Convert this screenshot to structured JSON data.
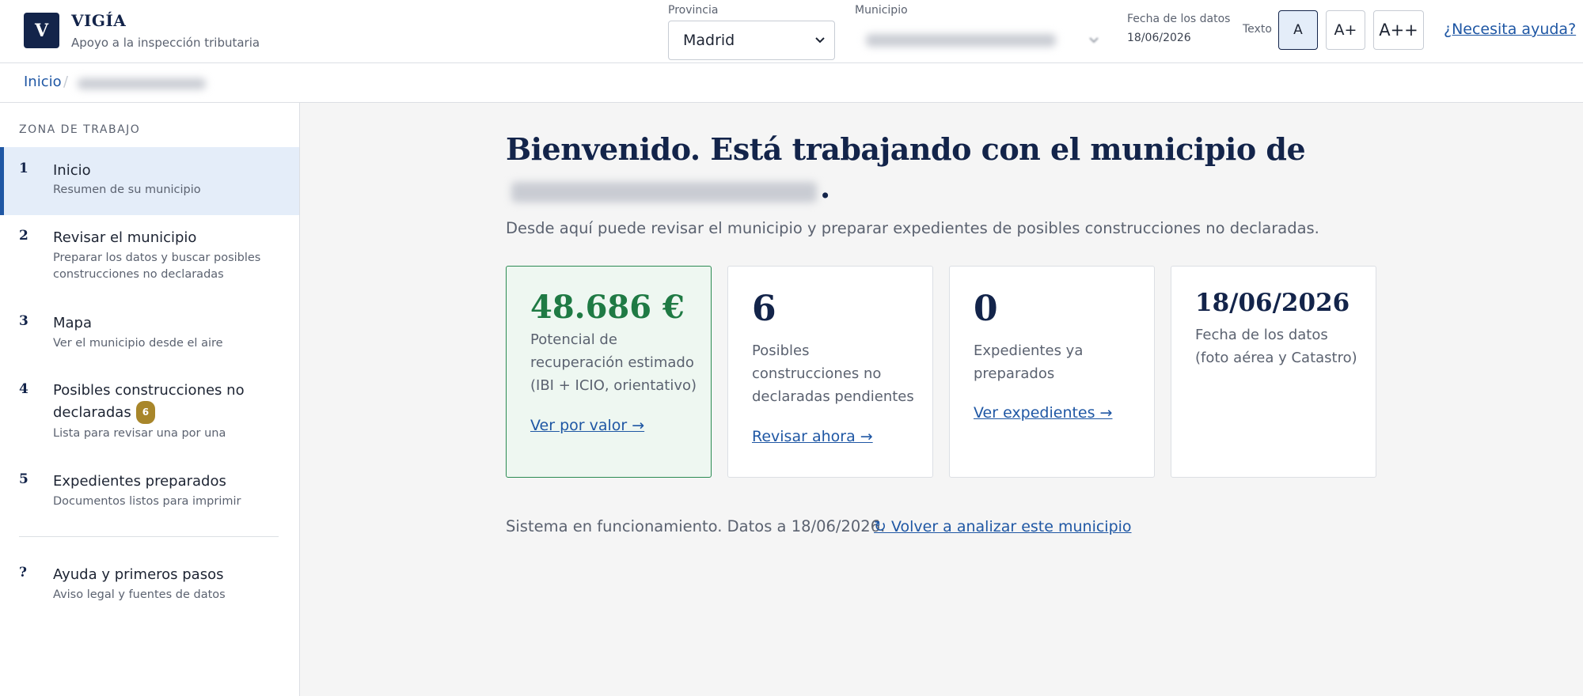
{
  "brand": {
    "logo_letter": "V",
    "name": "VIGÍA",
    "subtitle": "Apoyo a la inspección tributaria"
  },
  "header": {
    "provincia_label": "Provincia",
    "provincia_value": "Madrid",
    "municipio_label": "Municipio",
    "fecha_label": "Fecha de los datos",
    "fecha_value": "18/06/2026",
    "texto_label": "Texto",
    "size_buttons": [
      "A",
      "A+",
      "A++"
    ],
    "help_link": "¿Necesita ayuda?"
  },
  "breadcrumb": {
    "home": "Inicio",
    "separator": "/"
  },
  "sidebar": {
    "heading": "ZONA DE TRABAJO",
    "items": [
      {
        "num": "1",
        "title": "Inicio",
        "desc": "Resumen de su municipio"
      },
      {
        "num": "2",
        "title": "Revisar el municipio",
        "desc": "Preparar los datos y buscar posibles construcciones no declaradas"
      },
      {
        "num": "3",
        "title": "Mapa",
        "desc": "Ver el municipio desde el aire"
      },
      {
        "num": "4",
        "title": "Posibles construcciones no declaradas",
        "badge": "6",
        "desc": "Lista para revisar una por una"
      },
      {
        "num": "5",
        "title": "Expedientes preparados",
        "desc": "Documentos listos para imprimir"
      },
      {
        "num": "?",
        "title": "Ayuda y primeros pasos",
        "desc": "Aviso legal y fuentes de datos"
      }
    ]
  },
  "main": {
    "title": "Bienvenido. Está trabajando con el municipio de",
    "title_end": ".",
    "subtitle": "Desde aquí puede revisar el municipio y preparar expedientes de posibles construcciones no declaradas.",
    "cards": [
      {
        "value": "48.686 €",
        "desc": "Potencial de recuperación estimado (IBI + ICIO, orientativo)",
        "link": "Ver por valor →"
      },
      {
        "value": "6",
        "desc": "Posibles construcciones no declaradas pendientes",
        "link": "Revisar ahora →"
      },
      {
        "value": "0",
        "desc": "Expedientes ya preparados",
        "link": "Ver expedientes →"
      },
      {
        "value": "18/06/2026",
        "desc": "Fecha de los datos (foto aérea y Catastro)"
      }
    ],
    "status_text": "Sistema en funcionamiento. Datos a 18/06/2026.",
    "status_link": "↻ Volver a analizar este municipio"
  },
  "colors": {
    "navy": "#13244a",
    "link": "#1f57a4",
    "green": "#1f7a44",
    "badge": "#a8862a"
  },
  "icons": {
    "select_chevron": "chevron-down-icon",
    "refresh": "refresh-icon"
  }
}
